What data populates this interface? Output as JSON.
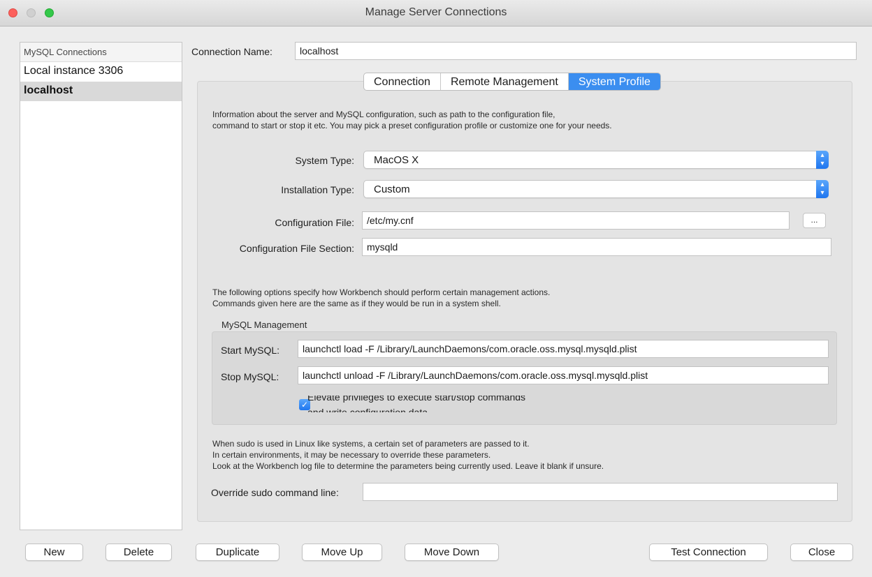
{
  "window": {
    "title": "Manage Server Connections"
  },
  "sidebar": {
    "header": "MySQL Connections",
    "items": [
      {
        "label": "Local instance 3306",
        "selected": false
      },
      {
        "label": "localhost",
        "selected": true
      }
    ]
  },
  "connection_name": {
    "label": "Connection Name:",
    "value": "localhost"
  },
  "tabs": [
    {
      "label": "Connection",
      "active": false
    },
    {
      "label": "Remote Management",
      "active": false
    },
    {
      "label": "System Profile",
      "active": true
    }
  ],
  "profile": {
    "intro_line1": "Information about the server and MySQL configuration, such as path to the configuration file,",
    "intro_line2": "command to start or stop it etc. You may pick a preset configuration profile or customize one for your needs.",
    "system_type": {
      "label": "System Type:",
      "value": "MacOS X"
    },
    "installation_type": {
      "label": "Installation Type:",
      "value": "Custom"
    },
    "config_file": {
      "label": "Configuration File:",
      "value": "/etc/my.cnf",
      "browse_label": "..."
    },
    "config_section": {
      "label": "Configuration File Section:",
      "value": "mysqld"
    },
    "options_line1": "The following options specify how Workbench should perform certain management actions.",
    "options_line2": "Commands given here are the same as if they would be run in a system shell.",
    "management": {
      "title": "MySQL Management",
      "start": {
        "label": "Start MySQL:",
        "value": "launchctl load -F /Library/LaunchDaemons/com.oracle.oss.mysql.mysqld.plist"
      },
      "stop": {
        "label": "Stop MySQL:",
        "value": "launchctl unload -F /Library/LaunchDaemons/com.oracle.oss.mysql.mysqld.plist"
      },
      "elevate": {
        "line1": "Elevate privileges to execute start/stop commands",
        "line2": "and write configuration data",
        "checked": true
      }
    },
    "sudo_line1": "When sudo is used in Linux like systems, a certain set of parameters are passed to it.",
    "sudo_line2": "In certain environments, it may be necessary to override these parameters.",
    "sudo_line3": "Look at the Workbench log file to determine the parameters being currently used. Leave it blank if unsure.",
    "sudo_override": {
      "label": "Override sudo command line:",
      "value": ""
    }
  },
  "buttons": {
    "new": "New",
    "delete": "Delete",
    "duplicate": "Duplicate",
    "move_up": "Move Up",
    "move_down": "Move Down",
    "test_connection": "Test Connection",
    "close": "Close"
  },
  "colors": {
    "accent": "#3b8ef0",
    "close_light": "#fc605c",
    "zoom_light": "#34c84a"
  }
}
